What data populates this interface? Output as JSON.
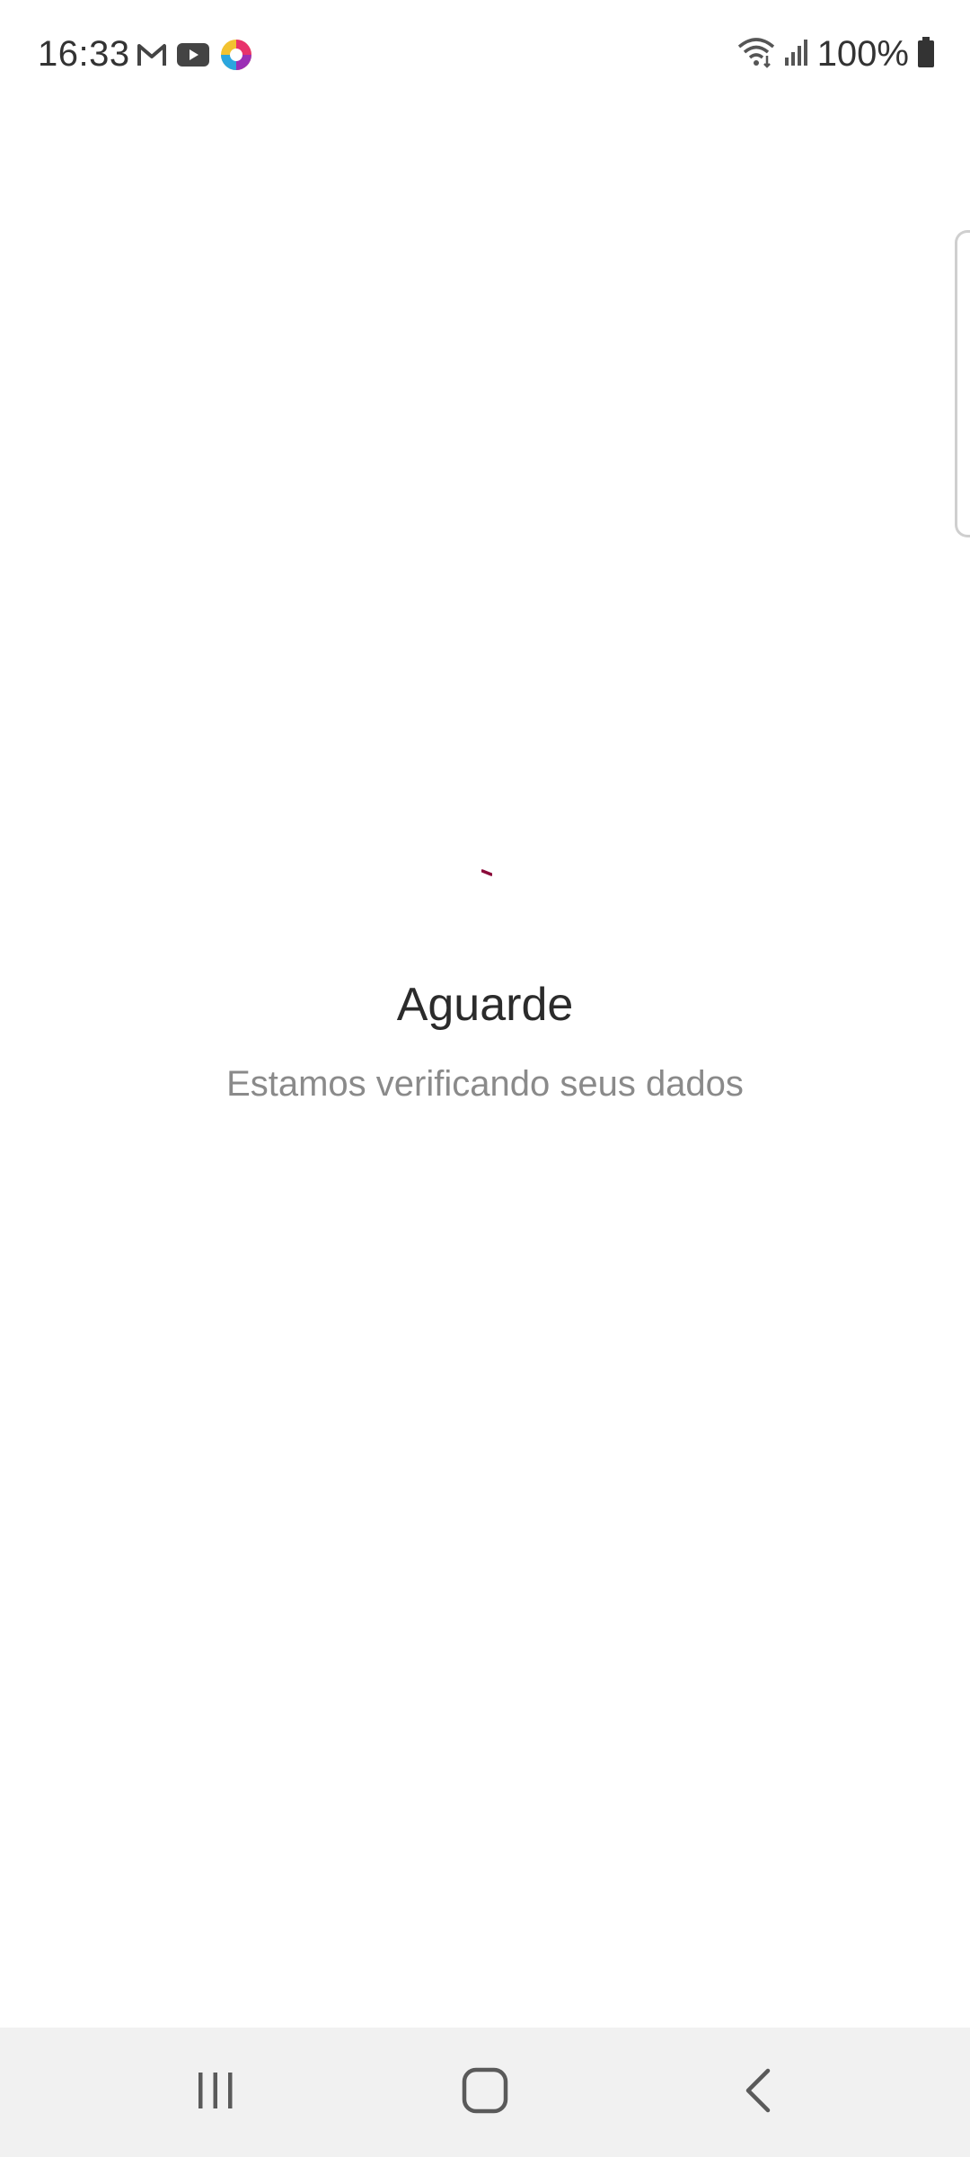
{
  "status_bar": {
    "time": "16:33",
    "battery": "100%",
    "notification_icons": [
      "gmail-icon",
      "youtube-icon",
      "app-icon"
    ],
    "system_icons": [
      "wifi-icon",
      "signal-icon",
      "battery-icon"
    ]
  },
  "loading": {
    "title": "Aguarde",
    "message": "Estamos verificando seus dados",
    "spinner_color": "#8b0a3a"
  },
  "colors": {
    "background": "#ffffff",
    "title_text": "#2b2b2b",
    "message_text": "#8a8a8a",
    "nav_bar": "#f1f1f1"
  },
  "nav_bar": {
    "buttons": [
      "recent-apps",
      "home",
      "back"
    ]
  }
}
